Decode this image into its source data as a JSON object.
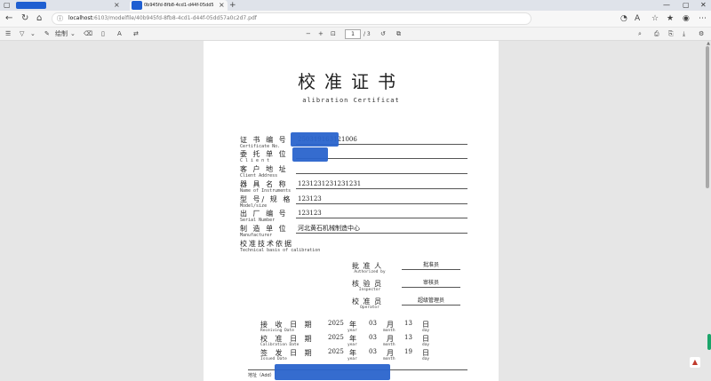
{
  "browser": {
    "tab1_title": "",
    "tab2_title": "0b945fd-8fb8-4cd1-d44f-05dd5",
    "url_host": "localhost:",
    "url_path": "6103/modelfile/40b945fd-8fb8-4cd1-d44f-05dd57a0c2d7.pdf"
  },
  "pdf_toolbar": {
    "draw_label": "绘制",
    "read_aloud_label": "A",
    "page_current": "1",
    "page_total": "/ 3"
  },
  "certificate": {
    "title": "校准证书",
    "subtitle": "alibration Certificat",
    "fields": [
      {
        "label": "证 书 编 号",
        "en": "Certificate No.",
        "value": "250319163121006"
      },
      {
        "label": "委 托 单 位",
        "en": "C l i e n t",
        "value": ""
      },
      {
        "label": "客 户 地 址",
        "en": "Client  Address",
        "value": ""
      },
      {
        "label": "器 具 名 称",
        "en": "Name of Instruments",
        "value": "1231231231231231"
      },
      {
        "label": "型 号/ 规 格",
        "en": "Model/size",
        "value": "123123"
      },
      {
        "label": "出 厂 编 号",
        "en": "Serial Number",
        "value": "123123"
      },
      {
        "label": "制 造 单 位",
        "en": "Manufacturer",
        "value": "河北黄石机械制造中心"
      },
      {
        "label": "校准技术依据",
        "en": "Technical basis of calibration",
        "value": ""
      }
    ],
    "signatures": [
      {
        "label": "批 准 人",
        "en": "Authorized by",
        "value": "批准员"
      },
      {
        "label": "核 验 员",
        "en": "Inspector",
        "value": "审核员"
      },
      {
        "label": "校 准 员",
        "en": "Operator",
        "value": "超级管理员"
      }
    ],
    "dates": [
      {
        "label": "接 收 日 期",
        "en": "Receiving  Date",
        "year": "2025",
        "month": "03",
        "day": "13"
      },
      {
        "label": "校 准 日 期",
        "en": "Calibration  Date",
        "year": "2025",
        "month": "03",
        "day": "13"
      },
      {
        "label": "签 发 日 期",
        "en": "Issued  Date",
        "year": "2025",
        "month": "03",
        "day": "19"
      }
    ],
    "unit_year": "年",
    "unit_month": "月",
    "unit_day": "日",
    "unit_year_en": "year",
    "unit_month_en": "month",
    "unit_day_en": "day",
    "footer_label": "地址（Add）"
  },
  "colors": {
    "redaction": "#2a64cc",
    "scroll_handle": "#1ba56a"
  }
}
